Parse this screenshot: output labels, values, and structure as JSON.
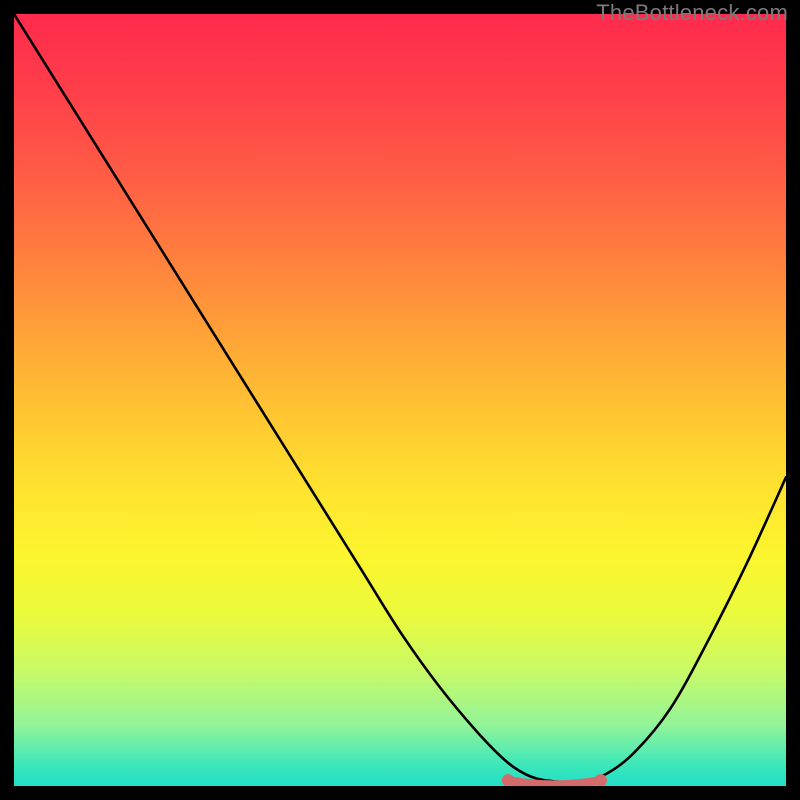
{
  "watermark": "TheBottleneck.com",
  "colors": {
    "background": "#000000",
    "gradient_top": "#ff2a4d",
    "gradient_mid": "#ffe42f",
    "gradient_bottom": "#20dfc8",
    "curve": "#000000",
    "flat_segment": "#d46a6a",
    "flat_endpoints": "#d46a6a"
  },
  "chart_data": {
    "type": "line",
    "title": "",
    "xlabel": "",
    "ylabel": "",
    "xlim": [
      0,
      100
    ],
    "ylim": [
      0,
      100
    ],
    "grid": false,
    "series": [
      {
        "name": "bottleneck-curve",
        "x": [
          0,
          5,
          10,
          15,
          20,
          25,
          30,
          35,
          40,
          45,
          50,
          55,
          60,
          64,
          67,
          70,
          73,
          76,
          80,
          85,
          90,
          95,
          100
        ],
        "values": [
          100,
          92,
          84,
          76,
          68,
          60,
          52,
          44,
          36,
          28,
          20,
          13,
          7,
          3,
          1.2,
          0.6,
          0.6,
          1.2,
          4,
          10,
          19,
          29,
          40
        ]
      }
    ],
    "annotations": [
      {
        "name": "optimal-flat-region",
        "x_range": [
          64,
          76
        ],
        "y": 0.6,
        "color": "#d46a6a"
      }
    ]
  }
}
